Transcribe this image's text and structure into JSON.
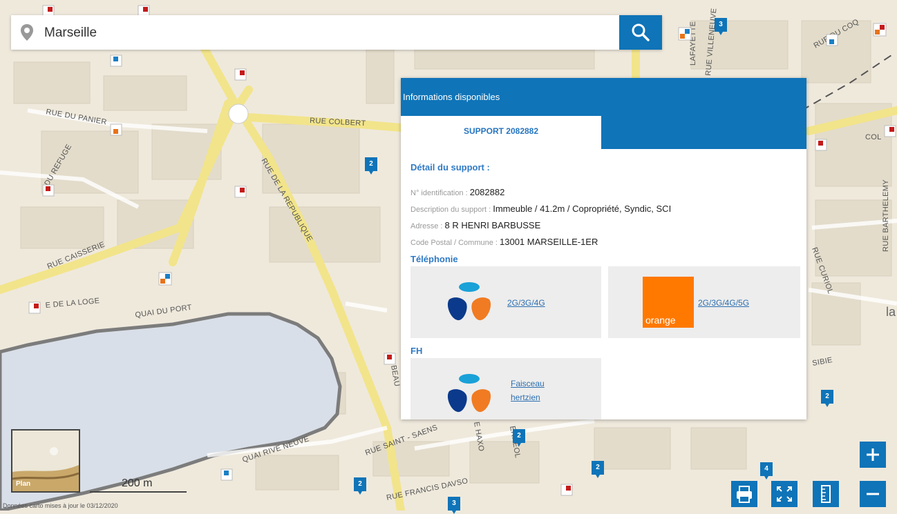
{
  "search": {
    "value": "Marseille",
    "placeholder": ""
  },
  "map_labels": {
    "rue_du_panier": "RUE DU PANIER",
    "rue_colbert": "RUE COLBERT",
    "du_refuge": "DU REFUGE",
    "rue_caisserie": "RUE CAISSERIE",
    "rue_de_la_loge": "E DE LA LOGE",
    "quai_du_port": "QUAI DU PORT",
    "quai_rive_neuve": "QUAI RIVE NEUVE",
    "rue_saint_saens": "RUE SAINT - SAENS",
    "rue_francis_davso": "RUE FRANCIS DAVSO",
    "rue_du_coq": "RUE DU COQ",
    "lafayette": "LAFAYETTE",
    "rue_villeneuve": "RUE VILLENEUVE",
    "rue_barthelemy": "RUE BARTHELEMY",
    "rue_curiol": "RUE CURIOL",
    "col": "COL",
    "sibie": "SIBIE",
    "rue_de_la_republique": "RUE DE LA REPUBLIQUE",
    "e_haxo": "E HAXO",
    "erreol": "ERREOL",
    "beau": "BEAU",
    "la": "la"
  },
  "clusters": [
    "3",
    "2",
    "2",
    "2",
    "2",
    "2",
    "4",
    "3",
    "2"
  ],
  "panel": {
    "header": "Informations disponibles",
    "tab": "SUPPORT 2082882",
    "detail_title": "Détail du support :",
    "rows": [
      {
        "label": "N° identification : ",
        "value": "2082882"
      },
      {
        "label": "Description du support : ",
        "value": "Immeuble / 41.2m / Copropriété, Syndic, SCI"
      },
      {
        "label": "Adresse : ",
        "value": "8 R HENRI BARBUSSE"
      },
      {
        "label": "Code Postal / Commune : ",
        "value": "13001 MARSEILLE-1ER"
      }
    ],
    "telephonie_title": "Téléphonie",
    "operators": [
      {
        "name": "bouygues-logo",
        "link": "2G/3G/4G"
      },
      {
        "name": "orange-logo",
        "logo_text": "orange",
        "link": "2G/3G/4G/5G"
      }
    ],
    "fh_title": "FH",
    "fh": [
      {
        "name": "bouygues-logo",
        "link_line1": "Faisceau",
        "link_line2": "hertzien"
      }
    ]
  },
  "minimap": {
    "label": "Plan"
  },
  "scale": {
    "label": "200 m"
  },
  "attribution": "Données carto mises à jour le 03/12/2020",
  "controls": [
    "zoom-in",
    "zoom-out",
    "print",
    "fullscreen",
    "measure"
  ],
  "colors": {
    "accent": "#0f74b8",
    "water": "#d9dfe8",
    "road": "#f2e48a",
    "orange": "#ff7900"
  }
}
